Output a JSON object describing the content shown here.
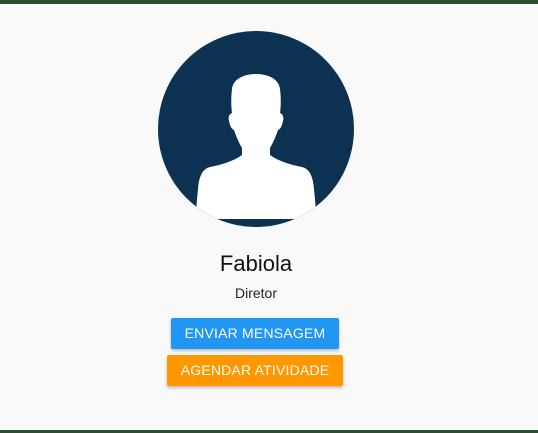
{
  "profile": {
    "name": "Fabiola",
    "role": "Diretor",
    "avatar_icon": "user-silhouette-icon"
  },
  "actions": {
    "send_message_label": "ENVIAR MENSAGEM",
    "schedule_activity_label": "AGENDAR ATIVIDADE"
  },
  "colors": {
    "avatar_background": "#0d3150",
    "primary_button": "#2196f3",
    "warning_button": "#ff9800",
    "frame_bar": "#2e4f2f"
  }
}
